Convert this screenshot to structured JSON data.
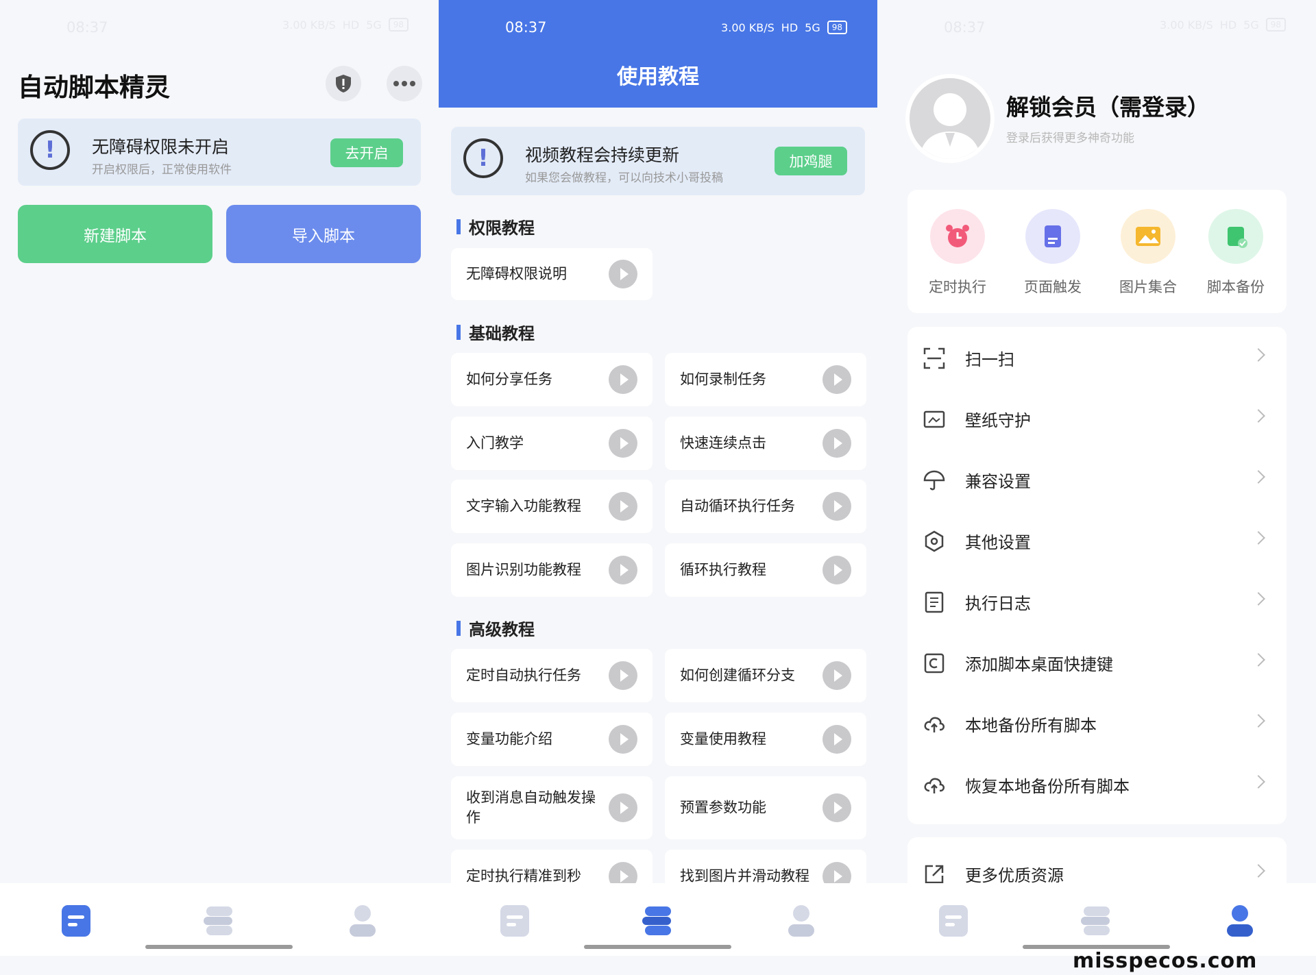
{
  "status": {
    "time": "08:37",
    "speed": "3.00 KB/S",
    "hd": "HD",
    "signal": "5G",
    "battery": "98"
  },
  "panel1": {
    "title": "自动脚本精灵",
    "alert": {
      "title": "无障碍权限未开启",
      "subtitle": "开启权限后，正常使用软件",
      "button": "去开启"
    },
    "new_script": "新建脚本",
    "import_script": "导入脚本"
  },
  "panel2": {
    "header_title": "使用教程",
    "alert": {
      "title": "视频教程会持续更新",
      "subtitle": "如果您会做教程，可以向技术小哥投稿",
      "button": "加鸡腿"
    },
    "sections": {
      "permission": "权限教程",
      "basic": "基础教程",
      "advanced": "高级教程"
    },
    "cards": [
      "无障碍权限说明",
      "如何分享任务",
      "如何录制任务",
      "入门教学",
      "快速连续点击",
      "文字输入功能教程",
      "自动循环执行任务",
      "图片识别功能教程",
      "循环执行教程",
      "定时自动执行任务",
      "如何创建循环分支",
      "变量功能介绍",
      "变量使用教程",
      "收到消息自动触发操作",
      "预置参数功能",
      "定时执行精准到秒",
      "找到图片并滑动教程"
    ]
  },
  "panel3": {
    "user_name": "解锁会员（需登录）",
    "user_sub": "登录后获得更多神奇功能",
    "features": [
      "定时执行",
      "页面触发",
      "图片集合",
      "脚本备份"
    ],
    "menu": [
      "扫一扫",
      "壁纸守护",
      "兼容设置",
      "其他设置",
      "执行日志",
      "添加脚本桌面快捷键",
      "本地备份所有脚本",
      "恢复本地备份所有脚本"
    ],
    "more": "更多优质资源"
  },
  "watermark": "misspecos.com",
  "colors": {
    "accent_blue": "#4876e6",
    "green": "#5ccf8b",
    "light_blue_card": "#e3ebf7"
  }
}
